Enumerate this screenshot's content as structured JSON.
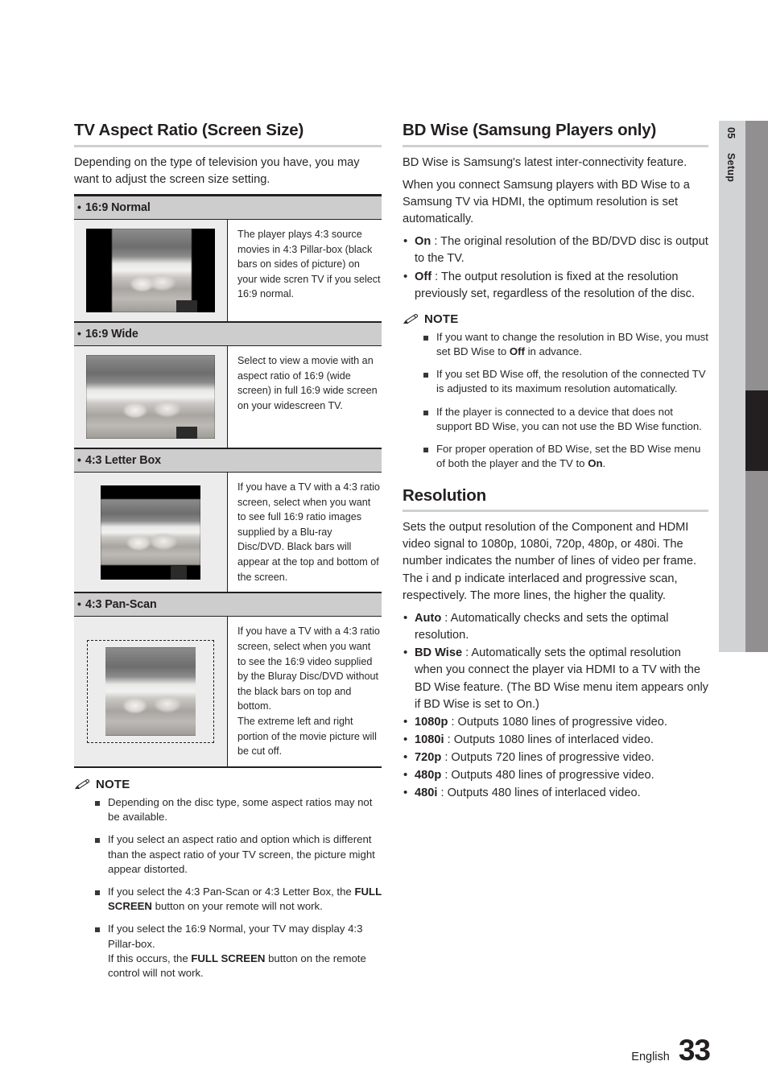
{
  "side_tab": {
    "number": "05",
    "label": "Setup"
  },
  "footer": {
    "language": "English",
    "page_number": "33"
  },
  "left_column": {
    "section_title": "TV Aspect Ratio (Screen Size)",
    "intro": "Depending on the type of television you have, you may want to adjust the screen size setting.",
    "table": [
      {
        "heading": "16:9 Normal",
        "description": "The player plays 4:3 source movies in 4:3 Pillar-box (black bars on sides of picture) on your wide scren TV if you select 16:9 normal.",
        "thumb": "pillar-box"
      },
      {
        "heading": "16:9 Wide",
        "description": "Select to view a movie with an aspect ratio of 16:9 (wide screen) in full 16:9 wide screen on your widescreen TV.",
        "thumb": "wide"
      },
      {
        "heading": "4:3 Letter Box",
        "description": "If you have a TV with a 4:3 ratio screen, select when you want to see full 16:9 ratio images supplied by a Blu-ray Disc/DVD. Black bars will appear at the top and bottom of the screen.",
        "thumb": "letter-box"
      },
      {
        "heading": "4:3 Pan-Scan",
        "description": "If you have a TV with a 4:3 ratio screen, select when you want to see the 16:9 video supplied by the Bluray Disc/DVD without the black bars on top and bottom.\nThe extreme left and right portion of the movie picture will be cut off.",
        "thumb": "pan-scan"
      }
    ],
    "note": {
      "label": "NOTE",
      "items": [
        {
          "parts": [
            {
              "text": "Depending on the disc type, some aspect ratios may not be available.",
              "bold": false
            }
          ]
        },
        {
          "parts": [
            {
              "text": "If you select an aspect ratio and option which is different than the aspect ratio of your TV screen, the picture might appear distorted.",
              "bold": false
            }
          ]
        },
        {
          "parts": [
            {
              "text": "If you select the 4:3 Pan-Scan or 4:3 Letter Box, the ",
              "bold": false
            },
            {
              "text": "FULL SCREEN",
              "bold": true
            },
            {
              "text": " button on your remote will not work.",
              "bold": false
            }
          ]
        },
        {
          "parts": [
            {
              "text": "If you select the 16:9 Normal, your TV may display 4:3 Pillar-box.\nIf this occurs, the ",
              "bold": false
            },
            {
              "text": "FULL SCREEN",
              "bold": true
            },
            {
              "text": " button on the remote control will not work.",
              "bold": false
            }
          ]
        }
      ]
    }
  },
  "right_column": {
    "bdwise": {
      "section_title": "BD Wise (Samsung Players only)",
      "paragraphs": [
        "BD Wise is Samsung's latest inter-connectivity feature.",
        "When you connect Samsung players with BD Wise to a Samsung TV via HDMI, the optimum resolution is set automatically."
      ],
      "options": [
        {
          "term": "On",
          "text": " : The original resolution of the BD/DVD disc is output to the TV."
        },
        {
          "term": "Off",
          "text": " : The output resolution is fixed at the resolution previously set, regardless of the resolution of the disc."
        }
      ],
      "note": {
        "label": "NOTE",
        "items": [
          {
            "parts": [
              {
                "text": "If you want to change the resolution in BD Wise, you must set BD Wise to ",
                "bold": false
              },
              {
                "text": "Off",
                "bold": true
              },
              {
                "text": " in advance.",
                "bold": false
              }
            ]
          },
          {
            "parts": [
              {
                "text": "If you set BD Wise off, the resolution of the connected TV is adjusted to its maximum resolution automatically.",
                "bold": false
              }
            ]
          },
          {
            "parts": [
              {
                "text": "If the player is connected to a device that does not support BD Wise, you can not use the BD Wise function.",
                "bold": false
              }
            ]
          },
          {
            "parts": [
              {
                "text": "For proper operation of BD Wise, set the BD Wise menu of both the player and the TV to ",
                "bold": false
              },
              {
                "text": "On",
                "bold": true
              },
              {
                "text": ".",
                "bold": false
              }
            ]
          }
        ]
      }
    },
    "resolution": {
      "section_title": "Resolution",
      "paragraph": "Sets the output resolution of the Component and HDMI video signal to 1080p, 1080i, 720p, 480p, or 480i. The number indicates the number of lines of video per frame. The i and p indicate interlaced and progressive scan, respectively. The more lines, the higher the quality.",
      "options": [
        {
          "term": "Auto",
          "text": " : Automatically checks and sets the optimal resolution."
        },
        {
          "term": "BD Wise",
          "text": " : Automatically sets the optimal resolution when you connect the player via HDMI to a TV with the BD Wise feature. (The BD Wise menu item appears only if BD Wise is set to On.)"
        },
        {
          "term": "1080p",
          "text": " : Outputs 1080 lines of progressive video."
        },
        {
          "term": "1080i",
          "text": " : Outputs 1080 lines of interlaced video."
        },
        {
          "term": "720p",
          "text": " : Outputs 720 lines of progressive video."
        },
        {
          "term": "480p",
          "text": " : Outputs 480 lines of progressive video."
        },
        {
          "term": "480i",
          "text": " : Outputs 480 lines of interlaced video."
        }
      ]
    }
  },
  "colors": {
    "table_header_bg": "#cdcdcd",
    "table_cell_bg": "#ececec",
    "rule": "#cfd0d1",
    "tab_light": "#d2d3d4",
    "tab_dark": "#918f90",
    "tab_black": "#231f20",
    "text": "#231f20"
  }
}
